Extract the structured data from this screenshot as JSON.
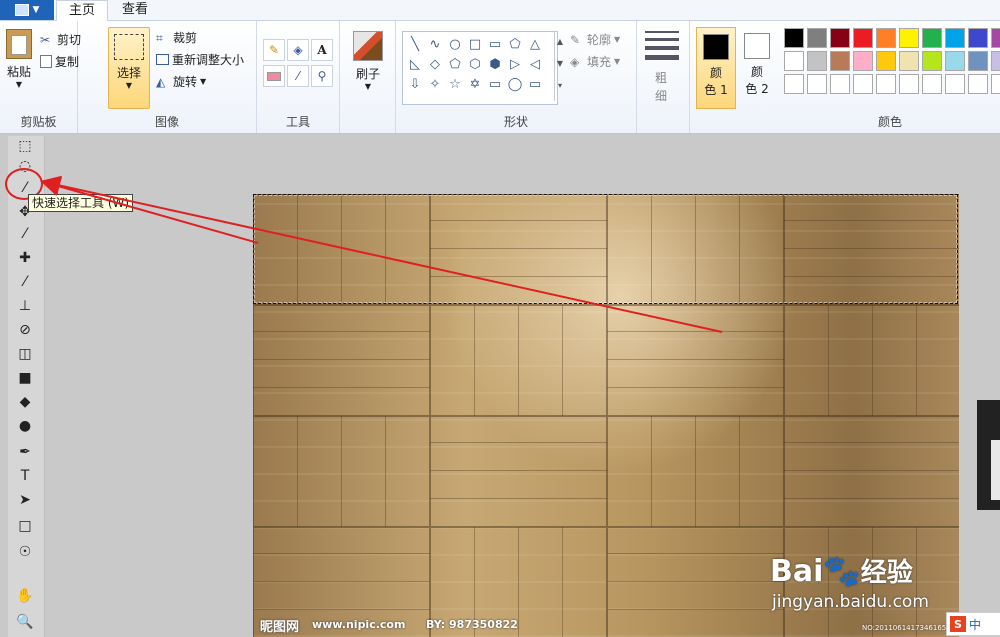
{
  "tabs": {
    "home": "主页",
    "view": "查看"
  },
  "clipboard": {
    "paste": "粘贴",
    "cut": "剪切",
    "copy": "复制",
    "group": "剪贴板"
  },
  "image": {
    "select": "选择",
    "crop": "裁剪",
    "resize": "重新调整大小",
    "rotate": "旋转",
    "group": "图像"
  },
  "tools": {
    "group": "工具",
    "text_tool": "A"
  },
  "brush": {
    "label": "刷子"
  },
  "shapes": {
    "outline": "轮廓",
    "fill": "填充",
    "group": "形状",
    "glyphs": [
      "╲",
      "∿",
      "○",
      "□",
      "▭",
      "⬠",
      "△",
      "◺",
      "◇",
      "⬠",
      "⬡",
      "⬢",
      "▷",
      "◁",
      "⇩",
      "✧",
      "☆",
      "✡",
      "▭",
      "◯",
      "▭"
    ]
  },
  "size": {
    "label_top": "粗",
    "label_bottom": "细"
  },
  "color_select": {
    "color1_top": "颜",
    "color1_bottom": "色 1",
    "color2_top": "颜",
    "color2_bottom": "色 2",
    "color1": "#000000",
    "color2": "#ffffff"
  },
  "colors": {
    "group": "颜色",
    "row1": [
      "#000000",
      "#7f7f7f",
      "#880015",
      "#ed1c24",
      "#ff7f27",
      "#fff200",
      "#22b14c",
      "#00a2e8",
      "#3f48cc",
      "#a349a4"
    ],
    "row2": [
      "#ffffff",
      "#c3c3c3",
      "#b97a57",
      "#ffaec9",
      "#ffc90e",
      "#efe4b0",
      "#b5e61d",
      "#99d9ea",
      "#7092be",
      "#c8bfe7"
    ],
    "row3": [
      "#ffffff",
      "#ffffff",
      "#ffffff",
      "#ffffff",
      "#ffffff",
      "#ffffff",
      "#ffffff",
      "#ffffff",
      "#ffffff",
      "#ffffff"
    ]
  },
  "photoshop_tools": [
    "⬚",
    "◌",
    "⁄",
    "✥",
    "⁄",
    "✚",
    "⁄",
    "⊥",
    "⊘",
    "◫",
    "■",
    "◆",
    "●",
    "✒",
    "T",
    "➤",
    "□",
    "☉",
    "✋",
    "🔍"
  ],
  "tooltip": "快速选择工具 (W)",
  "watermark": {
    "nipic_cn": "昵图网",
    "nipic_url": "www.nipic.com",
    "by": "BY: 987350822",
    "baidu": "Bai",
    "baidu2": "经验",
    "baidu_url": "jingyan.baidu.com",
    "id_text": "NO:20110614173461659"
  },
  "ime": {
    "mark": "S",
    "lang": "中"
  }
}
